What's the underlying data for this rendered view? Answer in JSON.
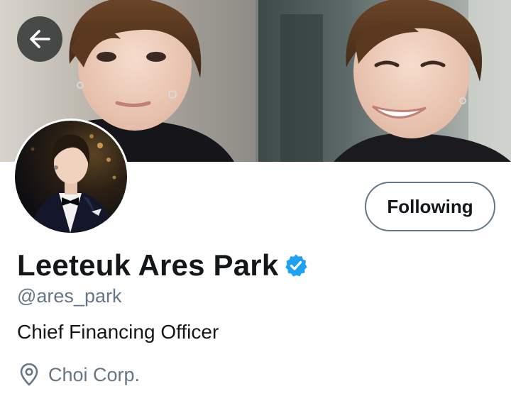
{
  "header": {
    "back_icon": "arrow-left-icon",
    "banner_icon": "header-photo"
  },
  "profile": {
    "display_name": "Leeteuk Ares Park",
    "verified_icon": "verified-badge-icon",
    "handle": "@ares_park",
    "bio": "Chief Financing Officer",
    "location_icon": "location-pin-icon",
    "location": "Choi Corp.",
    "avatar": "avatar-photo"
  },
  "actions": {
    "follow_label": "Following"
  },
  "colors": {
    "verified_blue": "#1da1f2",
    "text_primary": "#14171a",
    "text_secondary": "#657786",
    "button_border": "#657786"
  }
}
